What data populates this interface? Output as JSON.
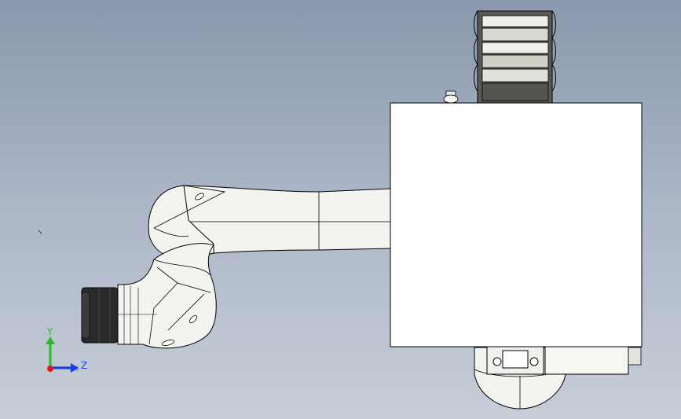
{
  "viewport": {
    "background_top": "#8a98ad",
    "background_bottom": "#c7ced8"
  },
  "triad": {
    "y_label": "Y",
    "z_label": "Z",
    "y_color": "#22c022",
    "z_color": "#1a3fe0",
    "x_color": "#e01a1a"
  },
  "model": {
    "body_color": "#f3f3f0",
    "edge_color": "#000000",
    "chain_dark": "#4a4a46",
    "chain_light": "#e6e6e0",
    "end_effector_color": "#1e1e1e"
  }
}
